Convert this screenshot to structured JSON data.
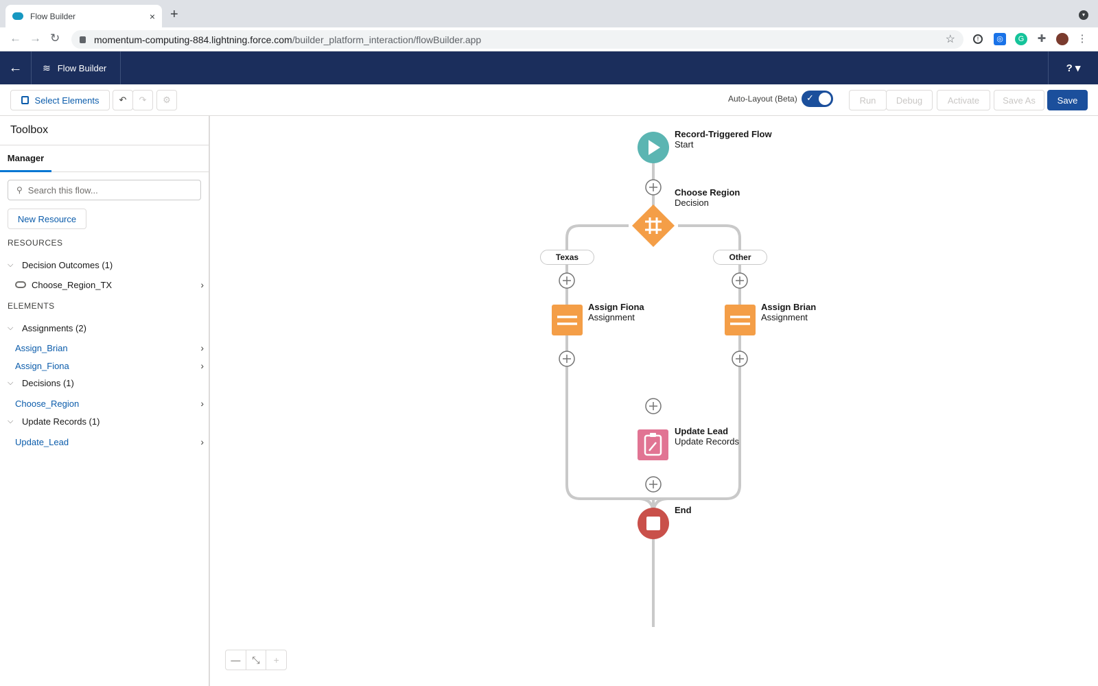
{
  "browser": {
    "tab_title": "Flow Builder",
    "tab_close": "×",
    "new_tab": "+",
    "url_host": "momentum-computing-884.lightning.force.com",
    "url_path": "/builder_platform_interaction/flowBuilder.app"
  },
  "header": {
    "back_icon": "←",
    "title": "Flow Builder",
    "help": "? ▾"
  },
  "toolbar": {
    "select_elements": "Select Elements",
    "undo": "↶",
    "redo": "↷",
    "settings": "⚙",
    "auto_layout_label": "Auto-Layout (Beta)",
    "auto_layout_on": true,
    "run": "Run",
    "debug": "Debug",
    "activate": "Activate",
    "save_as": "Save As",
    "save": "Save"
  },
  "sidebar": {
    "title": "Toolbox",
    "tab": "Manager",
    "search_placeholder": "Search this flow...",
    "new_resource": "New Resource",
    "resources_label": "RESOURCES",
    "decision_outcomes": "Decision Outcomes (1)",
    "outcome_item": "Choose_Region_TX",
    "elements_label": "ELEMENTS",
    "assignments": "Assignments (2)",
    "assign_brian": "Assign_Brian",
    "assign_fiona": "Assign_Fiona",
    "decisions": "Decisions (1)",
    "choose_region": "Choose_Region",
    "update_records": "Update Records (1)",
    "update_lead": "Update_Lead"
  },
  "canvas": {
    "start": {
      "title": "Record-Triggered Flow",
      "subtitle": "Start"
    },
    "decision": {
      "title": "Choose Region",
      "subtitle": "Decision"
    },
    "branch_left": "Texas",
    "branch_right": "Other",
    "assign_left": {
      "title": "Assign Fiona",
      "subtitle": "Assignment"
    },
    "assign_right": {
      "title": "Assign Brian",
      "subtitle": "Assignment"
    },
    "update": {
      "title": "Update Lead",
      "subtitle": "Update Records"
    },
    "end": {
      "title": "End"
    },
    "zoom_out": "—",
    "fit": "⤡",
    "zoom_in": "+"
  },
  "colors": {
    "start": "#5bb5b2",
    "decision": "#f49e47",
    "assignment": "#f49e47",
    "update": "#e17493",
    "end": "#c9504a",
    "brand": "#1b4f9c"
  }
}
